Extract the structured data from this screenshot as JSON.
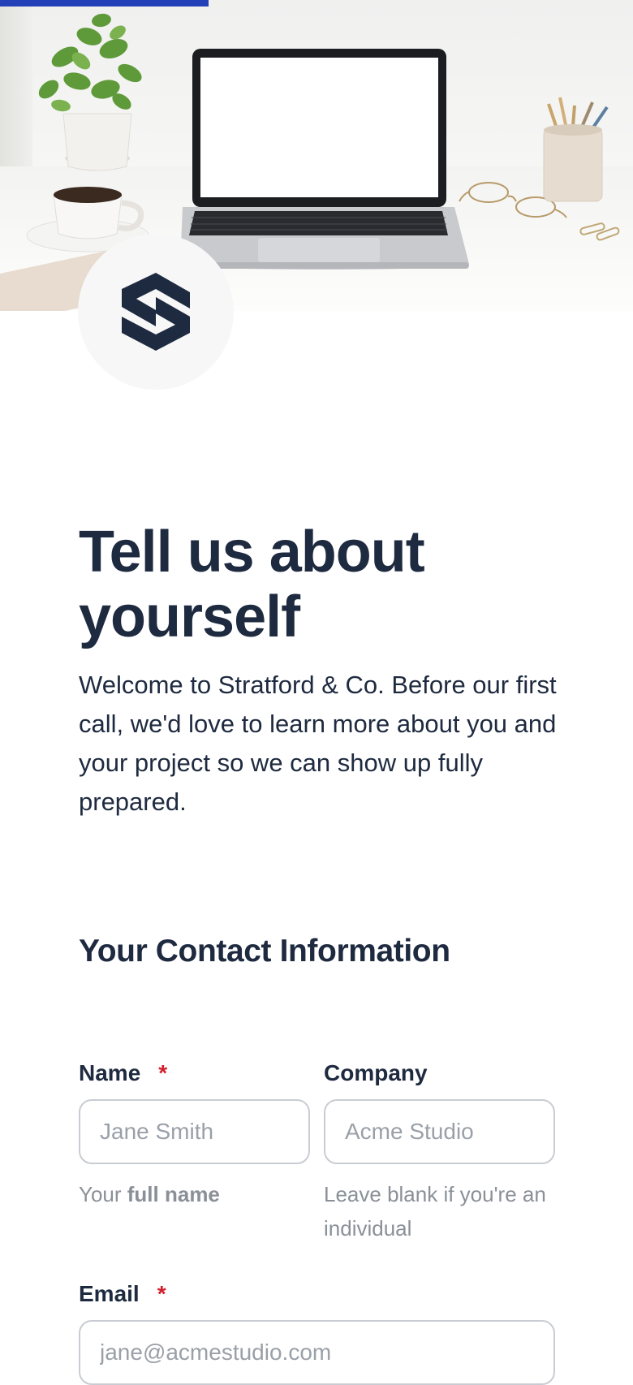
{
  "progress": {
    "fraction": 0.33
  },
  "hero": {
    "image": "workspace desk with laptop, plant, coffee cup, glasses and pencil holder"
  },
  "logo": {
    "icon": "stratford-s-logo-icon",
    "color": "#1e2a3f"
  },
  "page": {
    "title": "Tell us about yourself",
    "intro": "Welcome to Stratford & Co. Before our first call, we'd love to learn more about you and your project so we can show up fully prepared."
  },
  "section": {
    "title": "Your Contact Information"
  },
  "fields": {
    "name": {
      "label": "Name",
      "required_mark": "*",
      "placeholder": "Jane Smith",
      "help_prefix": "Your ",
      "help_bold": "full name"
    },
    "company": {
      "label": "Company",
      "placeholder": "Acme Studio",
      "help": "Leave blank if you're an individual"
    },
    "email": {
      "label": "Email",
      "required_mark": "*",
      "placeholder": "jane@acmestudio.com"
    }
  },
  "colors": {
    "accent": "#2340b8",
    "text": "#1e2a3f",
    "required": "#d11f2b",
    "muted": "#8a9098",
    "border": "#c9ccd2"
  }
}
